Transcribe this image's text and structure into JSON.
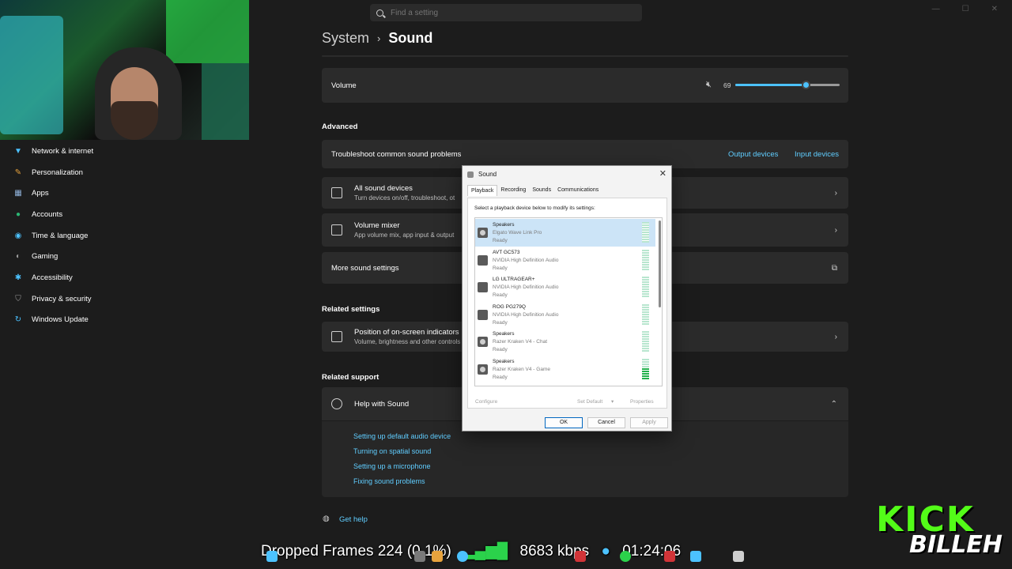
{
  "search": {
    "placeholder": "Find a setting"
  },
  "breadcrumb": {
    "parent": "System",
    "separator": "›",
    "current": "Sound"
  },
  "sidebar": {
    "items": [
      {
        "label": "Network & internet",
        "icon": "wifi-icon",
        "color": "#4cc2ff"
      },
      {
        "label": "Personalization",
        "icon": "brush-icon",
        "color": "#e8a33d"
      },
      {
        "label": "Apps",
        "icon": "apps-icon",
        "color": "#8fb1d9"
      },
      {
        "label": "Accounts",
        "icon": "person-icon",
        "color": "#2bb673"
      },
      {
        "label": "Time & language",
        "icon": "globe-icon",
        "color": "#4cc2ff"
      },
      {
        "label": "Gaming",
        "icon": "gamepad-icon",
        "color": "#9a9a9a"
      },
      {
        "label": "Accessibility",
        "icon": "accessibility-icon",
        "color": "#4cc2ff"
      },
      {
        "label": "Privacy & security",
        "icon": "shield-icon",
        "color": "#9a9a9a"
      },
      {
        "label": "Windows Update",
        "icon": "update-icon",
        "color": "#4cc2ff"
      }
    ]
  },
  "volume": {
    "label": "Volume",
    "value": "69",
    "level": 0.69
  },
  "advanced": {
    "title": "Advanced",
    "troubleshoot": {
      "label": "Troubleshoot common sound problems",
      "output_link": "Output devices",
      "input_link": "Input devices"
    },
    "all_devices": {
      "title": "All sound devices",
      "sub": "Turn devices on/off, troubleshoot, ot"
    },
    "mixer": {
      "title": "Volume mixer",
      "sub": "App volume mix, app input & output"
    },
    "more": {
      "title": "More sound settings"
    }
  },
  "related_settings": {
    "title": "Related settings",
    "indicators": {
      "title": "Position of on-screen indicators",
      "sub": "Volume, brightness and other controls"
    }
  },
  "related_support": {
    "title": "Related support",
    "help": {
      "title": "Help with Sound"
    },
    "links": [
      "Setting up default audio device",
      "Turning on spatial sound",
      "Setting up a microphone",
      "Fixing sound problems"
    ]
  },
  "get_help": "Get help",
  "dialog": {
    "title": "Sound",
    "close": "✕",
    "tabs": [
      "Playback",
      "Recording",
      "Sounds",
      "Communications"
    ],
    "instruction": "Select a playback device below to modify its settings:",
    "devices": [
      {
        "name": "Speakers",
        "desc": "Elgato Wave Link Pro",
        "status": "Ready",
        "level": 0.0,
        "selected": true
      },
      {
        "name": "AVT GC573",
        "desc": "NVIDIA High Definition Audio",
        "status": "Ready",
        "level": 0.0,
        "selected": false
      },
      {
        "name": "LG ULTRAGEAR+",
        "desc": "NVIDIA High Definition Audio",
        "status": "Ready",
        "level": 0.0,
        "selected": false
      },
      {
        "name": "ROG PG279Q",
        "desc": "NVIDIA High Definition Audio",
        "status": "Ready",
        "level": 0.0,
        "selected": false
      },
      {
        "name": "Speakers",
        "desc": "Razer Kraken V4 - Chat",
        "status": "Ready",
        "level": 0.0,
        "selected": false
      },
      {
        "name": "Speakers",
        "desc": "Razer Kraken V4 - Game",
        "status": "Ready",
        "level": 0.55,
        "selected": false
      }
    ],
    "configure": "Configure",
    "set_default": "Set Default",
    "properties": "Properties",
    "ok": "OK",
    "cancel": "Cancel",
    "apply": "Apply"
  },
  "overlay": {
    "dropped_frames": "Dropped Frames 224 (0.1%)",
    "bitrate": "8683 kbps",
    "time": "01:24:06"
  },
  "brand": {
    "kick": "KICK",
    "name": "BILLEH",
    "accent": "#53fc18"
  }
}
